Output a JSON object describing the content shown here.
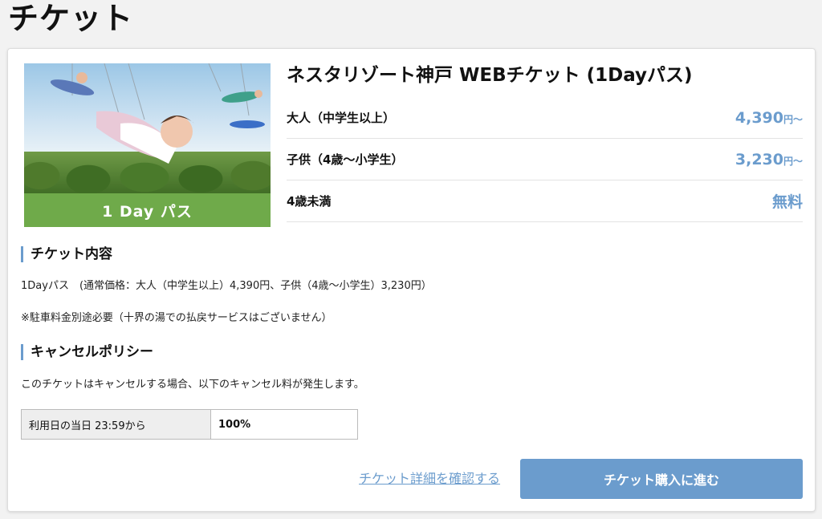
{
  "page": {
    "title": "チケット"
  },
  "ticket": {
    "title": "ネスタリゾート神戸 WEBチケット (1Dayパス)",
    "image_banner": "1 Day パス",
    "prices": [
      {
        "label": "大人（中学生以上）",
        "value": "4,390",
        "unit": "円〜"
      },
      {
        "label": "子供（4歳〜小学生）",
        "value": "3,230",
        "unit": "円〜"
      },
      {
        "label": "4歳未満",
        "value": "無料",
        "unit": ""
      }
    ]
  },
  "contents": {
    "heading": "チケット内容",
    "line1": "1Dayパス　(通常価格：大人（中学生以上）4,390円、子供（4歳〜小学生）3,230円）",
    "line2": "※駐車料金別途必要（十界の湯での払戻サービスはございません）"
  },
  "cancel": {
    "heading": "キャンセルポリシー",
    "description": "このチケットはキャンセルする場合、以下のキャンセル料が発生します。",
    "rows": [
      {
        "label": "利用日の当日 23:59から",
        "value": "100%"
      }
    ]
  },
  "actions": {
    "detail_link": "チケット詳細を確認する",
    "buy_button": "チケット購入に進む"
  },
  "colors": {
    "accent": "#6b9ccd",
    "banner_green": "#6faa4a"
  }
}
